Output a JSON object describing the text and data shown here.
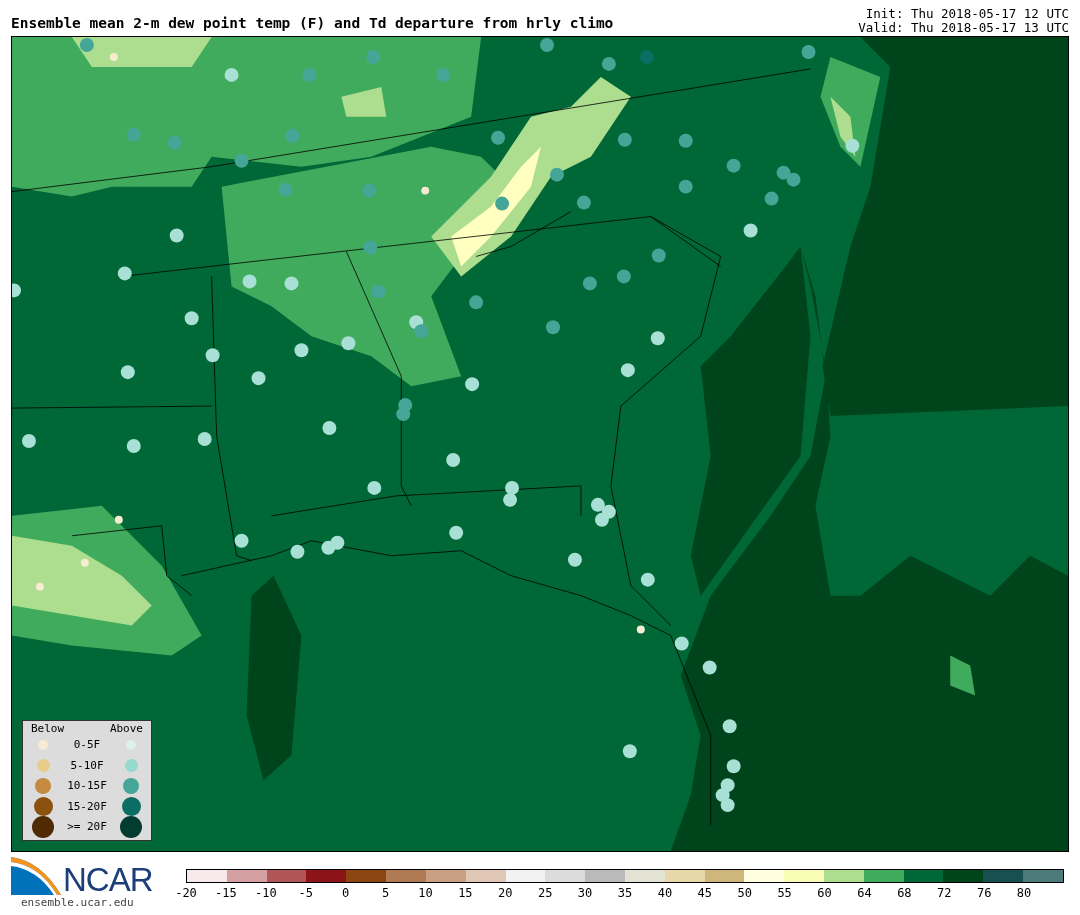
{
  "header": {
    "title": "Ensemble mean 2-m dew point temp (F) and Td departure from hrly climo",
    "init": "Init: Thu 2018-05-17 12 UTC",
    "valid": "Valid: Thu 2018-05-17 13 UTC"
  },
  "legend": {
    "below_label": "Below",
    "above_label": "Above",
    "rows": [
      {
        "label": "0-5F",
        "below": {
          "color": "#f5ecd2"
        },
        "above": {
          "color": "#dcf0ee"
        }
      },
      {
        "label": "5-10F",
        "below": {
          "color": "#e8cc8a"
        },
        "above": {
          "color": "#97d9cf"
        }
      },
      {
        "label": "10-15F",
        "below": {
          "color": "#c48a3f"
        },
        "above": {
          "color": "#45a698"
        }
      },
      {
        "label": "15-20F",
        "below": {
          "color": "#8c500f"
        },
        "above": {
          "color": "#0b6d64"
        }
      },
      {
        "label": ">= 20F",
        "below": {
          "color": "#4f2a05"
        },
        "above": {
          "color": "#033c30"
        }
      }
    ]
  },
  "colorbar": {
    "segments": [
      {
        "color": "#f7e9e9"
      },
      {
        "color": "#d4a0a2"
      },
      {
        "color": "#b05558"
      },
      {
        "color": "#8c1419"
      },
      {
        "color": "#8a4510"
      },
      {
        "color": "#b07a55"
      },
      {
        "color": "#c9a084"
      },
      {
        "color": "#e0c7b5"
      },
      {
        "color": "#f2f2f2"
      },
      {
        "color": "#dcdcdc"
      },
      {
        "color": "#bababa"
      },
      {
        "color": "#e2e3d3"
      },
      {
        "color": "#e7d7a9"
      },
      {
        "color": "#cfb77b"
      },
      {
        "color": "#ffffe0"
      },
      {
        "color": "#f9fcb4"
      },
      {
        "color": "#addd8e"
      },
      {
        "color": "#41ab5d"
      },
      {
        "color": "#006837"
      },
      {
        "color": "#00441b"
      },
      {
        "color": "#1a4f50"
      },
      {
        "color": "#4c7a7a"
      }
    ],
    "ticks": [
      "-20",
      "-15",
      "-10",
      "-5",
      "0",
      "5",
      "10",
      "15",
      "20",
      "25",
      "30",
      "35",
      "40",
      "45",
      "50",
      "55",
      "60",
      "64",
      "68",
      "72",
      "76",
      "80"
    ]
  },
  "footer": {
    "logo_text": "NCAR",
    "site": "ensemble.ucar.edu"
  }
}
